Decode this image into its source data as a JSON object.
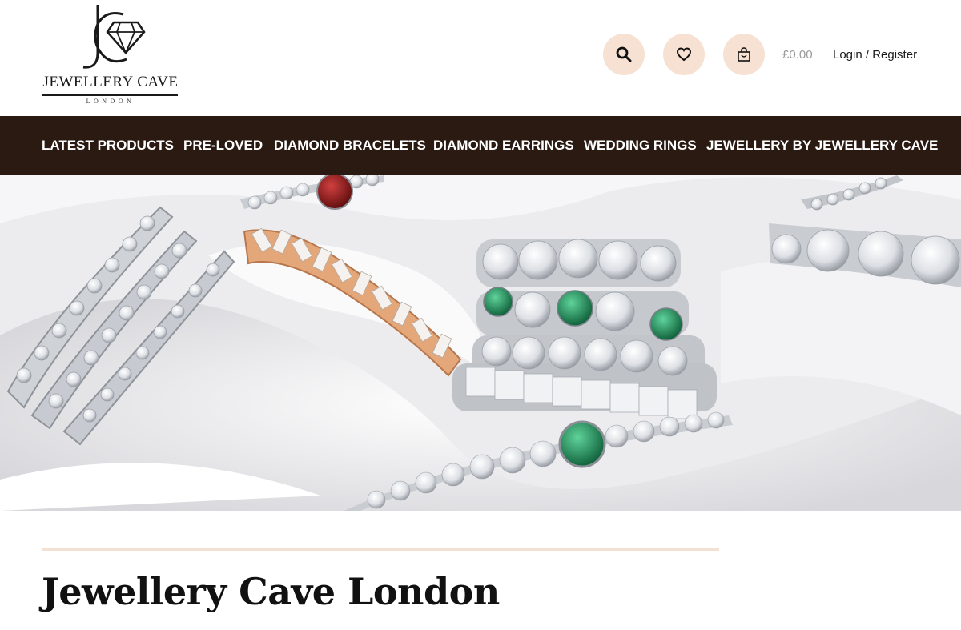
{
  "brand": {
    "name": "JEWELLERY CAVE",
    "subtitle": "LONDON"
  },
  "header": {
    "search_icon": "search-icon",
    "wishlist_icon": "heart-icon",
    "cart_icon": "shopping-bag-icon",
    "cart_total": "£0.00",
    "login_label": "Login / Register",
    "accent_color": "#f7e1d2"
  },
  "nav": {
    "background": "#2a1a12",
    "items": [
      {
        "label": "LATEST PRODUCTS"
      },
      {
        "label": "PRE-LOVED"
      },
      {
        "label": "DIAMOND BRACELETS"
      },
      {
        "label": "DIAMOND EARRINGS"
      },
      {
        "label": "WEDDING RINGS"
      },
      {
        "label": "JEWELLERY BY JEWELLERY CAVE"
      }
    ]
  },
  "hero": {
    "image": "diamond-rings-and-bracelets-on-white-satin"
  },
  "main": {
    "title": "Jewellery Cave London"
  }
}
